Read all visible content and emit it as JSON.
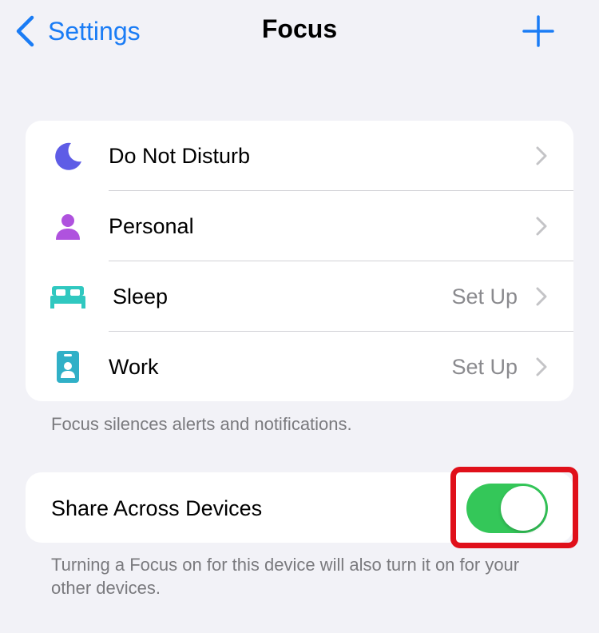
{
  "nav": {
    "back_label": "Settings",
    "title": "Focus",
    "add_icon": "plus-icon",
    "accent_color": "#1a7cf5"
  },
  "focus_modes": [
    {
      "label": "Do Not Disturb",
      "value": "",
      "icon": "moon-icon",
      "color": "#5e5ce6"
    },
    {
      "label": "Personal",
      "value": "",
      "icon": "person-icon",
      "color": "#af52de"
    },
    {
      "label": "Sleep",
      "value": "Set Up",
      "icon": "bed-icon",
      "color": "#30c8c0"
    },
    {
      "label": "Work",
      "value": "Set Up",
      "icon": "id-badge-icon",
      "color": "#30b0c7"
    }
  ],
  "focus_footer": "Focus silences alerts and notifications.",
  "share": {
    "label": "Share Across Devices",
    "enabled": true,
    "toggle_color": "#34c759",
    "highlight_color": "#e0101a"
  },
  "share_footer": "Turning a Focus on for this device will also turn it on for your other devices."
}
